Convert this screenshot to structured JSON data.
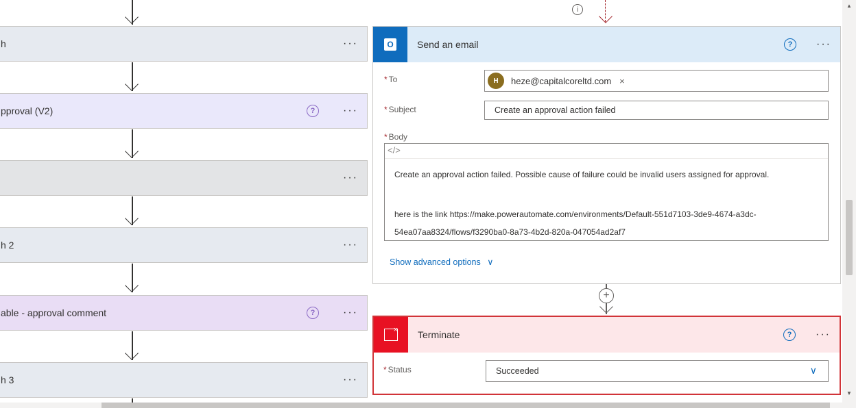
{
  "left_cards": [
    {
      "title": "h",
      "color": "#e6eaf0",
      "has_help": false
    },
    {
      "title": "pproval (V2)",
      "color": "#eae8fb",
      "has_help": true
    },
    {
      "title": "",
      "color": "#e3e4e6",
      "has_help": false
    },
    {
      "title": "h 2",
      "color": "#e6eaf0",
      "has_help": false
    },
    {
      "title": "able - approval comment",
      "color": "#e9ddf5",
      "has_help": true
    },
    {
      "title": "h 3",
      "color": "#e6eaf0",
      "has_help": false
    }
  ],
  "more_label": "···",
  "help_glyph": "?",
  "send_email": {
    "title": "Send an email",
    "to_label": "To",
    "to_avatar": "H",
    "to_value": "heze@capitalcoreltd.com",
    "remove_glyph": "×",
    "subject_label": "Subject",
    "subject_value": "Create an approval action failed",
    "body_label": "Body",
    "code_glyph": "</>",
    "body_line1": "Create an approval action failed. Possible cause of failure could be invalid users assigned for approval.",
    "body_line2": "here is the link https://make.powerautomate.com/environments/Default-551d7103-3de9-4674-a3dc-",
    "body_line3": "54ea07aa8324/flows/f3290ba0-8a73-4b2d-820a-047054ad2af7",
    "advanced_label": "Show advanced options",
    "chevron": "∨",
    "required_mark": "*"
  },
  "terminate": {
    "title": "Terminate",
    "status_label": "Status",
    "status_value": "Succeeded",
    "chevron": "∨"
  },
  "colors": {
    "accent": "#0f6cbd",
    "terminate_border": "#d13438",
    "email_header": "#dcebf8",
    "terminate_header": "#fde7e9"
  },
  "icons": {
    "outlook": "outlook-icon",
    "terminate": "terminate-icon",
    "info": "info-icon",
    "plus": "add-step-icon"
  },
  "info_glyph": "i",
  "plus_glyph": "+"
}
